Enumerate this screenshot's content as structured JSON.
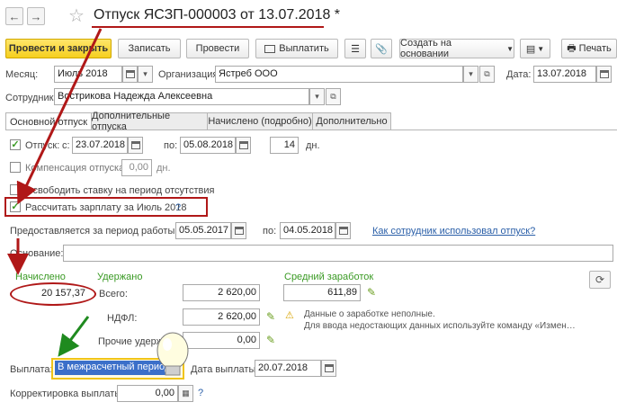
{
  "window": {
    "title": "Отпуск ЯСЗП-000003 от 13.07.2018 *"
  },
  "toolbar": {
    "post_close": "Провести и закрыть",
    "save": "Записать",
    "post": "Провести",
    "pay": "Выплатить",
    "create_based": "Создать на основании",
    "print": "Печать"
  },
  "header": {
    "month_label": "Месяц:",
    "month_value": "Июль 2018",
    "org_label": "Организация:",
    "org_value": "Ястреб ООО",
    "date_label": "Дата:",
    "date_value": "13.07.2018",
    "employee_label": "Сотрудник:",
    "employee_value": "Вострикова Надежда Алексеевна"
  },
  "tabs": [
    {
      "label": "Основной отпуск"
    },
    {
      "label": "Дополнительные отпуска"
    },
    {
      "label": "Начислено (подробно)"
    },
    {
      "label": "Дополнительно"
    }
  ],
  "vacation": {
    "label": "Отпуск:",
    "from_label": "с:",
    "from_value": "23.07.2018",
    "to_label": "по:",
    "to_value": "05.08.2018",
    "days_value": "14",
    "days_unit": "дн.",
    "compensation_label": "Компенсация отпуска",
    "compensation_value": "0,00",
    "compensation_unit": "дн.",
    "free_rate_label": "Освободить ставку на период отсутствия",
    "calc_salary_label": "Рассчитать зарплату за Июль 2018",
    "help_mark": "?",
    "period_label": "Предоставляется за период работы с:",
    "period_from": "05.05.2017",
    "period_to_label": "по:",
    "period_to": "04.05.2018",
    "used_link": "Как сотрудник использовал отпуск?",
    "reason_label": "Основание:",
    "reason_value": ""
  },
  "amounts": {
    "accrued_header": "Начислено",
    "accrued_value": "20 157,37",
    "withheld_header": "Удержано",
    "total_label": "Всего:",
    "total_value": "2 620,00",
    "ndfl_label": "НДФЛ:",
    "ndfl_value": "2 620,00",
    "other_label": "Прочие удержания:",
    "other_value": "0,00",
    "avg_header": "Средний заработок",
    "avg_value": "611,89",
    "warning_line1": "Данные о заработке неполные.",
    "warning_line2": "Для ввода недостающих данных используйте команду «Измен…"
  },
  "payment": {
    "label": "Выплата:",
    "value": "В межрасчетный период",
    "date_label": "Дата выплаты:",
    "date_value": "20.07.2018",
    "correction_label": "Корректировка выплаты:",
    "correction_value": "0,00",
    "help_mark": "?"
  },
  "colors": {
    "annotation_red": "#b01818",
    "annotation_green": "#1f8a1f",
    "primary_yellow": "#f5cf1f",
    "selection_blue": "#3b6fc9"
  }
}
